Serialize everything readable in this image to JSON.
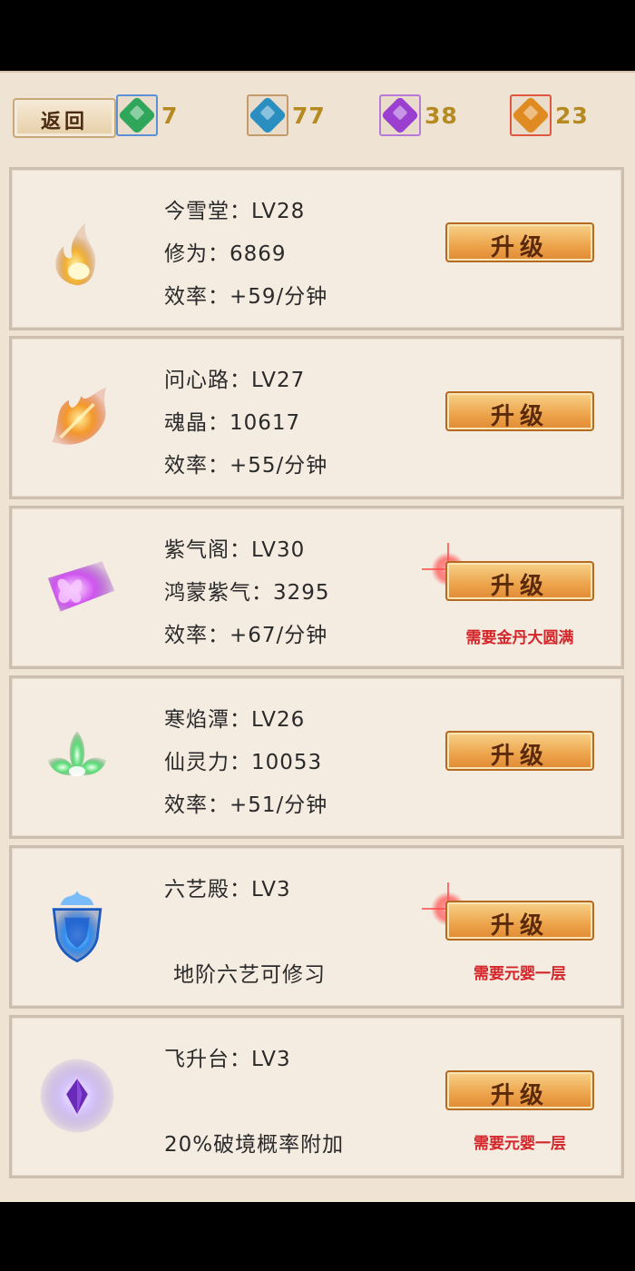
{
  "header": {
    "back_label": "返回",
    "resources": [
      {
        "name": "green-gem",
        "count": "7",
        "color": "#2fa65a",
        "border": "#5b8fd6"
      },
      {
        "name": "blue-gem",
        "count": "77",
        "color": "#2a8fc0",
        "border": "#c49a6b"
      },
      {
        "name": "purple-gem",
        "count": "38",
        "color": "#9a3fd0",
        "border": "#b77ad6"
      },
      {
        "name": "orange-gem",
        "count": "23",
        "color": "#e08a22",
        "border": "#e0573f"
      }
    ]
  },
  "buildings": [
    {
      "name_line": "今雪堂：LV28",
      "resource_line": "修为：6869",
      "rate_line": "效率：+59/分钟",
      "button": "升级",
      "requirement": "",
      "icon": "fire-icon",
      "accent": "#f0b43a",
      "alert": false
    },
    {
      "name_line": "问心路：LV27",
      "resource_line": "魂晶：10617",
      "rate_line": "效率：+55/分钟",
      "button": "升级",
      "requirement": "",
      "icon": "flame-phoenix-icon",
      "accent": "#f07a22",
      "alert": false
    },
    {
      "name_line": "紫气阁：LV30",
      "resource_line": "鸿蒙紫气：3295",
      "rate_line": "效率：+67/分钟",
      "button": "升级",
      "requirement": "需要金丹大圆满",
      "icon": "purple-butterfly-icon",
      "accent": "#c84ae0",
      "alert": true
    },
    {
      "name_line": "寒焰潭：LV26",
      "resource_line": "仙灵力：10053",
      "rate_line": "效率：+51/分钟",
      "button": "升级",
      "requirement": "",
      "icon": "green-lotus-icon",
      "accent": "#4fd06a",
      "alert": false
    },
    {
      "name_line": "六艺殿：LV3",
      "resource_line": "",
      "rate_line": "地阶六艺可修习",
      "button": "升级",
      "requirement": "需要元婴一层",
      "icon": "blue-shield-icon",
      "accent": "#2a7ae0",
      "alert": true
    },
    {
      "name_line": "飞升台：LV3",
      "resource_line": "",
      "rate_line": "20%破境概率附加",
      "button": "升级",
      "requirement": "需要元婴一层",
      "icon": "purple-crystal-icon",
      "accent": "#8a5ad0",
      "alert": false
    }
  ]
}
